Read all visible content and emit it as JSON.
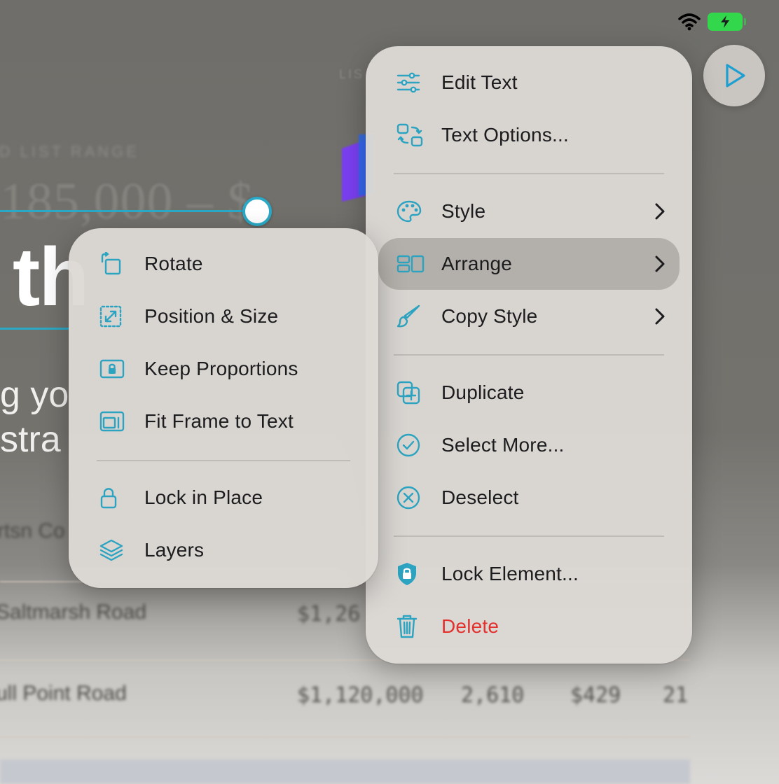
{
  "background": {
    "list_label": "LIS",
    "range_label": "ED LIST RANGE",
    "range_value": "185,000 – $",
    "title_fragment": "th",
    "body_line1": "g yo",
    "body_line2": "stra",
    "row_fragment_top": "rtsn Co",
    "rows": [
      {
        "name": "Saltmarsh Road",
        "price": "$1,26"
      },
      {
        "name": "ull Point Road",
        "price": "$1,120,000",
        "sqft": "2,610",
        "ppsf": "$429",
        "extra": "21"
      }
    ]
  },
  "status_bar": {
    "wifi_icon": "wifi-icon",
    "battery_icon": "battery-charging-icon",
    "battery_color": "#32d74b"
  },
  "play_button": {
    "icon": "play-icon"
  },
  "main_menu": {
    "items": [
      {
        "label": "Edit Text",
        "icon": "sliders-icon"
      },
      {
        "label": "Text Options...",
        "icon": "text-options-icon"
      },
      {
        "label": "Style",
        "icon": "palette-icon"
      },
      {
        "label": "Arrange",
        "icon": "arrange-icon"
      },
      {
        "label": "Copy Style",
        "icon": "brush-icon"
      },
      {
        "label": "Duplicate",
        "icon": "duplicate-icon"
      },
      {
        "label": "Select More...",
        "icon": "checkmark-circle-icon"
      },
      {
        "label": "Deselect",
        "icon": "xmark-circle-icon"
      },
      {
        "label": "Lock Element...",
        "icon": "lock-shield-icon"
      },
      {
        "label": "Delete",
        "icon": "trash-icon"
      }
    ]
  },
  "arrange_submenu": {
    "items": [
      {
        "label": "Rotate",
        "icon": "rotate-icon"
      },
      {
        "label": "Position & Size",
        "icon": "resize-icon"
      },
      {
        "label": "Keep Proportions",
        "icon": "lock-box-icon"
      },
      {
        "label": "Fit Frame to Text",
        "icon": "frame-icon"
      },
      {
        "label": "Lock in Place",
        "icon": "lock-icon"
      },
      {
        "label": "Layers",
        "icon": "layers-icon"
      }
    ]
  },
  "colors": {
    "accent": "#2ca3c0",
    "danger": "#e2322f",
    "highlight": "#96928c"
  }
}
